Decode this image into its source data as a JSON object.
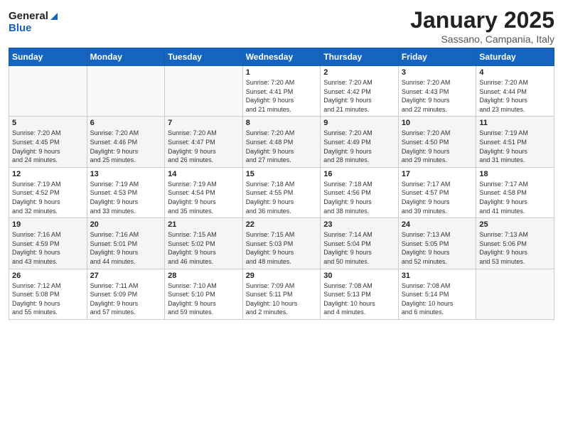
{
  "header": {
    "logo_general": "General",
    "logo_blue": "Blue",
    "month_title": "January 2025",
    "location": "Sassano, Campania, Italy"
  },
  "days_of_week": [
    "Sunday",
    "Monday",
    "Tuesday",
    "Wednesday",
    "Thursday",
    "Friday",
    "Saturday"
  ],
  "weeks": [
    [
      {
        "day": "",
        "info": ""
      },
      {
        "day": "",
        "info": ""
      },
      {
        "day": "",
        "info": ""
      },
      {
        "day": "1",
        "info": "Sunrise: 7:20 AM\nSunset: 4:41 PM\nDaylight: 9 hours\nand 21 minutes."
      },
      {
        "day": "2",
        "info": "Sunrise: 7:20 AM\nSunset: 4:42 PM\nDaylight: 9 hours\nand 21 minutes."
      },
      {
        "day": "3",
        "info": "Sunrise: 7:20 AM\nSunset: 4:43 PM\nDaylight: 9 hours\nand 22 minutes."
      },
      {
        "day": "4",
        "info": "Sunrise: 7:20 AM\nSunset: 4:44 PM\nDaylight: 9 hours\nand 23 minutes."
      }
    ],
    [
      {
        "day": "5",
        "info": "Sunrise: 7:20 AM\nSunset: 4:45 PM\nDaylight: 9 hours\nand 24 minutes."
      },
      {
        "day": "6",
        "info": "Sunrise: 7:20 AM\nSunset: 4:46 PM\nDaylight: 9 hours\nand 25 minutes."
      },
      {
        "day": "7",
        "info": "Sunrise: 7:20 AM\nSunset: 4:47 PM\nDaylight: 9 hours\nand 26 minutes."
      },
      {
        "day": "8",
        "info": "Sunrise: 7:20 AM\nSunset: 4:48 PM\nDaylight: 9 hours\nand 27 minutes."
      },
      {
        "day": "9",
        "info": "Sunrise: 7:20 AM\nSunset: 4:49 PM\nDaylight: 9 hours\nand 28 minutes."
      },
      {
        "day": "10",
        "info": "Sunrise: 7:20 AM\nSunset: 4:50 PM\nDaylight: 9 hours\nand 29 minutes."
      },
      {
        "day": "11",
        "info": "Sunrise: 7:19 AM\nSunset: 4:51 PM\nDaylight: 9 hours\nand 31 minutes."
      }
    ],
    [
      {
        "day": "12",
        "info": "Sunrise: 7:19 AM\nSunset: 4:52 PM\nDaylight: 9 hours\nand 32 minutes."
      },
      {
        "day": "13",
        "info": "Sunrise: 7:19 AM\nSunset: 4:53 PM\nDaylight: 9 hours\nand 33 minutes."
      },
      {
        "day": "14",
        "info": "Sunrise: 7:19 AM\nSunset: 4:54 PM\nDaylight: 9 hours\nand 35 minutes."
      },
      {
        "day": "15",
        "info": "Sunrise: 7:18 AM\nSunset: 4:55 PM\nDaylight: 9 hours\nand 36 minutes."
      },
      {
        "day": "16",
        "info": "Sunrise: 7:18 AM\nSunset: 4:56 PM\nDaylight: 9 hours\nand 38 minutes."
      },
      {
        "day": "17",
        "info": "Sunrise: 7:17 AM\nSunset: 4:57 PM\nDaylight: 9 hours\nand 39 minutes."
      },
      {
        "day": "18",
        "info": "Sunrise: 7:17 AM\nSunset: 4:58 PM\nDaylight: 9 hours\nand 41 minutes."
      }
    ],
    [
      {
        "day": "19",
        "info": "Sunrise: 7:16 AM\nSunset: 4:59 PM\nDaylight: 9 hours\nand 43 minutes."
      },
      {
        "day": "20",
        "info": "Sunrise: 7:16 AM\nSunset: 5:01 PM\nDaylight: 9 hours\nand 44 minutes."
      },
      {
        "day": "21",
        "info": "Sunrise: 7:15 AM\nSunset: 5:02 PM\nDaylight: 9 hours\nand 46 minutes."
      },
      {
        "day": "22",
        "info": "Sunrise: 7:15 AM\nSunset: 5:03 PM\nDaylight: 9 hours\nand 48 minutes."
      },
      {
        "day": "23",
        "info": "Sunrise: 7:14 AM\nSunset: 5:04 PM\nDaylight: 9 hours\nand 50 minutes."
      },
      {
        "day": "24",
        "info": "Sunrise: 7:13 AM\nSunset: 5:05 PM\nDaylight: 9 hours\nand 52 minutes."
      },
      {
        "day": "25",
        "info": "Sunrise: 7:13 AM\nSunset: 5:06 PM\nDaylight: 9 hours\nand 53 minutes."
      }
    ],
    [
      {
        "day": "26",
        "info": "Sunrise: 7:12 AM\nSunset: 5:08 PM\nDaylight: 9 hours\nand 55 minutes."
      },
      {
        "day": "27",
        "info": "Sunrise: 7:11 AM\nSunset: 5:09 PM\nDaylight: 9 hours\nand 57 minutes."
      },
      {
        "day": "28",
        "info": "Sunrise: 7:10 AM\nSunset: 5:10 PM\nDaylight: 9 hours\nand 59 minutes."
      },
      {
        "day": "29",
        "info": "Sunrise: 7:09 AM\nSunset: 5:11 PM\nDaylight: 10 hours\nand 2 minutes."
      },
      {
        "day": "30",
        "info": "Sunrise: 7:08 AM\nSunset: 5:13 PM\nDaylight: 10 hours\nand 4 minutes."
      },
      {
        "day": "31",
        "info": "Sunrise: 7:08 AM\nSunset: 5:14 PM\nDaylight: 10 hours\nand 6 minutes."
      },
      {
        "day": "",
        "info": ""
      }
    ]
  ]
}
